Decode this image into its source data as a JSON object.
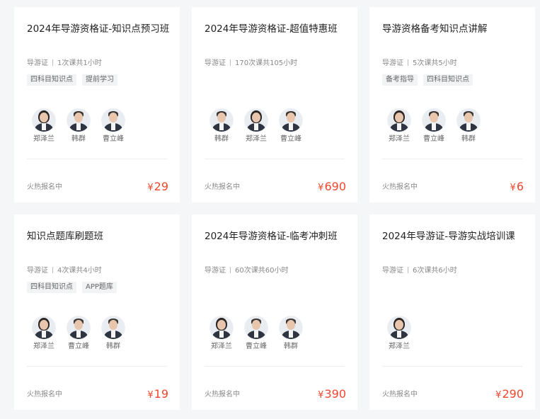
{
  "courses": [
    {
      "title": "2024年导游资格证-知识点预习班",
      "category": "导游证",
      "lessons": "1次课共1小时",
      "tags": [
        "四科目知识点",
        "提前学习"
      ],
      "teachers": [
        {
          "name": "郑泽兰",
          "gender": "female"
        },
        {
          "name": "韩群",
          "gender": "male"
        },
        {
          "name": "曹立峰",
          "gender": "male"
        }
      ],
      "status": "火热报名中",
      "currency": "¥",
      "price": "29"
    },
    {
      "title": "2024年导游资格证-超值特惠班",
      "category": "导游证",
      "lessons": "170次课共105小时",
      "tags": [],
      "teachers": [
        {
          "name": "韩群",
          "gender": "male"
        },
        {
          "name": "郑泽兰",
          "gender": "female"
        },
        {
          "name": "曹立峰",
          "gender": "male"
        }
      ],
      "status": "火热报名中",
      "currency": "¥",
      "price": "690"
    },
    {
      "title": "导游资格备考知识点讲解",
      "category": "导游证",
      "lessons": "5次课共5小时",
      "tags": [
        "备考指导",
        "四科目知识点"
      ],
      "teachers": [
        {
          "name": "郑泽兰",
          "gender": "female"
        },
        {
          "name": "曹立峰",
          "gender": "male"
        },
        {
          "name": "韩群",
          "gender": "male"
        }
      ],
      "status": "火热报名中",
      "currency": "¥",
      "price": "6"
    },
    {
      "title": "知识点题库刷题班",
      "category": "导游证",
      "lessons": "4次课共4小时",
      "tags": [
        "四科目知识点",
        "APP题库"
      ],
      "teachers": [
        {
          "name": "郑泽兰",
          "gender": "female"
        },
        {
          "name": "曹立峰",
          "gender": "male"
        },
        {
          "name": "韩群",
          "gender": "male"
        }
      ],
      "status": "火热报名中",
      "currency": "¥",
      "price": "19"
    },
    {
      "title": "2024年导游资格证-临考冲刺班",
      "category": "导游证",
      "lessons": "60次课共60小时",
      "tags": [],
      "teachers": [
        {
          "name": "郑泽兰",
          "gender": "female"
        },
        {
          "name": "曹立峰",
          "gender": "male"
        },
        {
          "name": "韩群",
          "gender": "male"
        }
      ],
      "status": "火热报名中",
      "currency": "¥",
      "price": "390"
    },
    {
      "title": "2024年导游证-导游实战培训课",
      "category": "导游证",
      "lessons": "6次课共6小时",
      "tags": [],
      "teachers": [
        {
          "name": "郑泽兰",
          "gender": "female"
        }
      ],
      "status": "火热报名中",
      "currency": "¥",
      "price": "290"
    }
  ],
  "colors": {
    "price": "#f0462e",
    "background": "#f5f6f8",
    "card": "#ffffff"
  }
}
